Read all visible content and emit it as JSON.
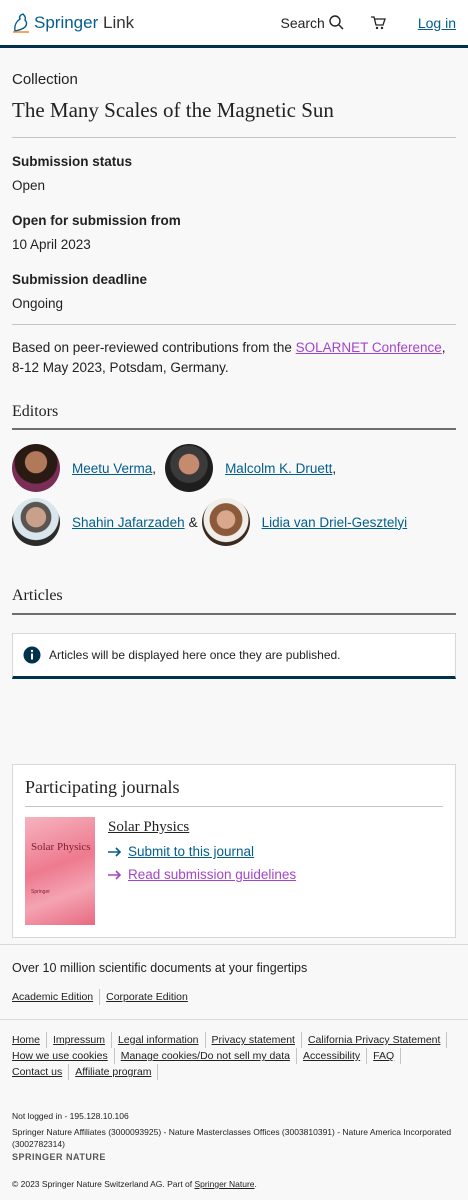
{
  "header": {
    "logo_brand": "Springer",
    "logo_suffix": "Link",
    "search_label": "Search",
    "login_label": "Log in"
  },
  "collection": {
    "kicker": "Collection",
    "title": "The Many Scales of the Magnetic Sun"
  },
  "submission": {
    "status_label": "Submission status",
    "status_value": "Open",
    "open_from_label": "Open for submission from",
    "open_from_value": "10 April 2023",
    "deadline_label": "Submission deadline",
    "deadline_value": "Ongoing"
  },
  "description": {
    "prefix": "Based on peer-reviewed contributions from the ",
    "link": "SOLARNET Conference",
    "suffix": ", 8-12 May 2023, Potsdam, Germany."
  },
  "editors": {
    "heading": "Editors",
    "list": [
      {
        "name": "Meetu Verma",
        "sep": ","
      },
      {
        "name": "Malcolm K. Druett",
        "sep": ","
      },
      {
        "name": "Shahin Jafarzadeh",
        "sep": "&"
      },
      {
        "name": "Lidia van Driel-Gesztelyi",
        "sep": ""
      }
    ]
  },
  "articles": {
    "heading": "Articles",
    "notice": "Articles will be displayed here once they are published."
  },
  "journals": {
    "heading": "Participating journals",
    "journal_title": "Solar Physics",
    "cover_title": "Solar Physics",
    "cover_publisher": "Springer",
    "submit_link": "Submit to this journal",
    "guidelines_link": "Read submission guidelines"
  },
  "footer": {
    "tagline": "Over 10 million scientific documents at your fingertips",
    "editions": [
      "Academic Edition",
      "Corporate Edition"
    ],
    "links": [
      "Home",
      "Impressum",
      "Legal information",
      "Privacy statement",
      "California Privacy Statement",
      "How we use cookies",
      "Manage cookies/Do not sell my data",
      "Accessibility",
      "FAQ",
      "Contact us",
      "Affiliate program"
    ],
    "login_status": "Not logged in - 195.128.10.106",
    "affiliates": "Springer Nature Affiliates (3000093925) - Nature Masterclasses Offices (3003810391) - Nature America Incorporated (3002782314)",
    "brand": "SPRINGER NATURE",
    "copyright_prefix": "© 2023 Springer Nature Switzerland AG. Part of ",
    "copyright_link": "Springer Nature",
    "copyright_suffix": "."
  },
  "colors": {
    "accent": "#025e8d",
    "visited_link": "#a345c9",
    "header_border": "#01324b"
  }
}
